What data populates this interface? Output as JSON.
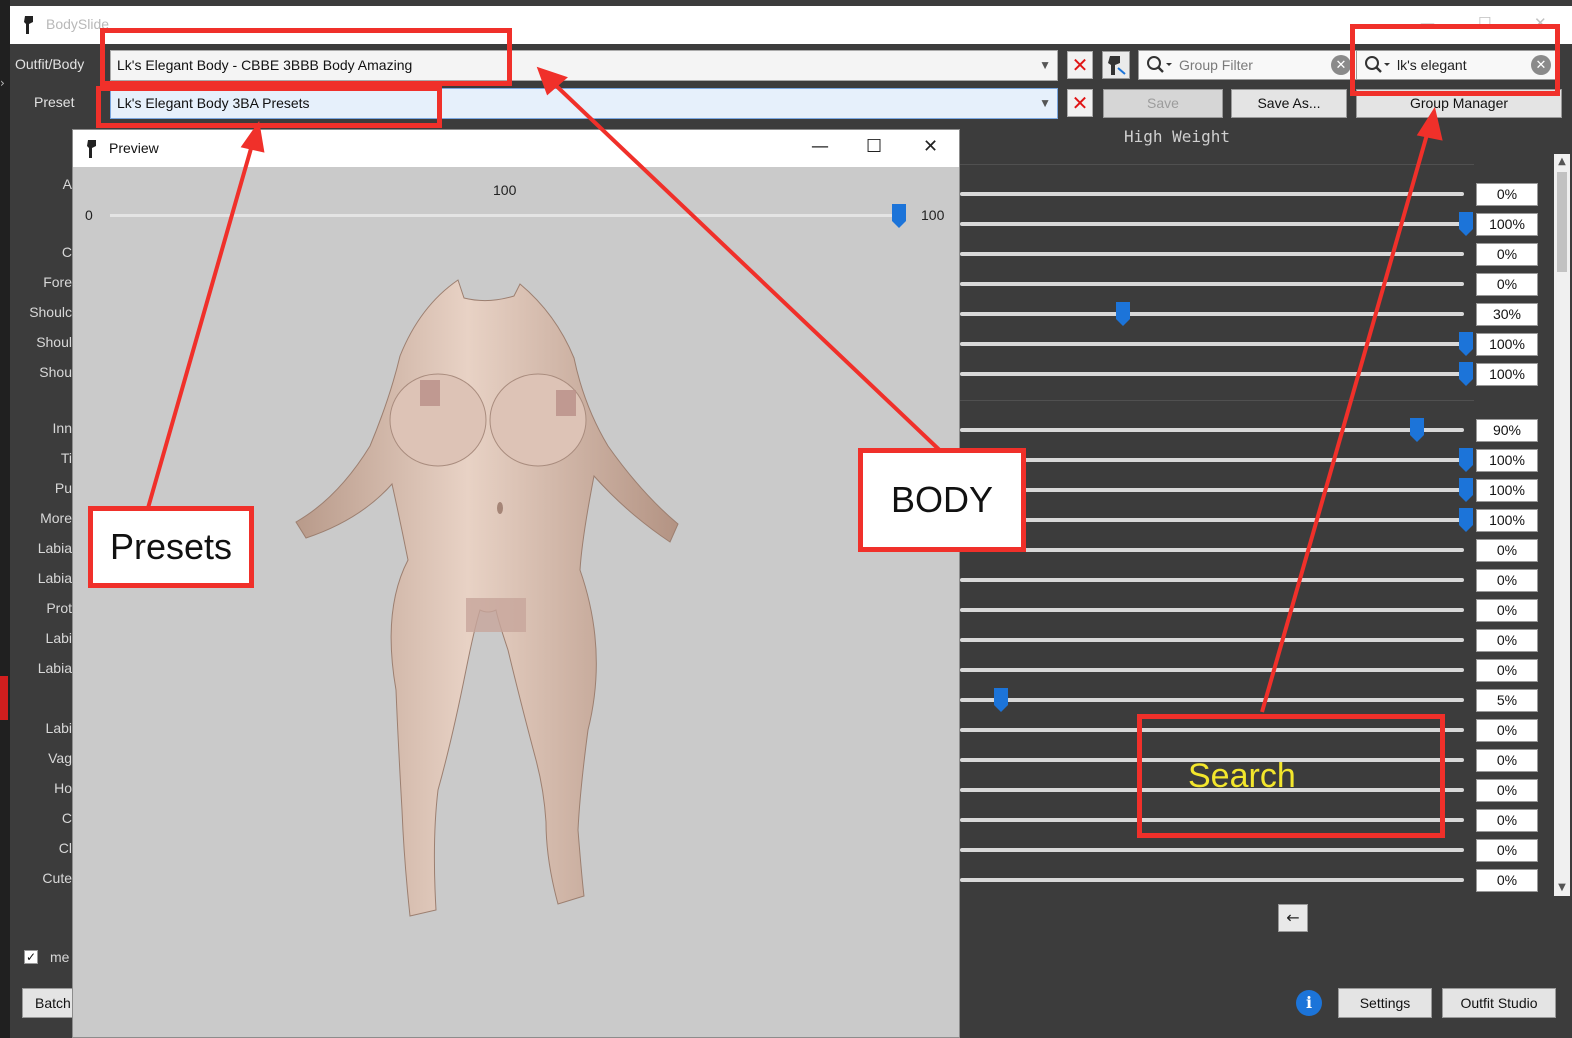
{
  "window": {
    "title": "BodySlide",
    "minimize": "—",
    "maximize": "☐",
    "close": "✕"
  },
  "outfit": {
    "label": "Outfit/Body",
    "value": "Lk's Elegant Body - CBBE 3BBB Body Amazing"
  },
  "preset": {
    "label": "Preset",
    "value": "Lk's Elegant Body 3BA Presets"
  },
  "group_filter": {
    "placeholder": "Group Filter"
  },
  "outfit_search": {
    "value": "lk's elegant"
  },
  "buttons": {
    "save": "Save",
    "save_as": "Save As...",
    "group_manager": "Group Manager",
    "back": "←",
    "info": "i",
    "settings": "Settings",
    "outfit_studio": "Outfit Studio",
    "batch": "Batch",
    "clear": "✕",
    "remove": "✕"
  },
  "weight_header": "High Weight",
  "slider_labels": [
    "A",
    "C",
    "Fore",
    "Shoulc",
    "Shoul",
    "Shou",
    "Inn",
    "Ti",
    "Pu",
    "More",
    "Labia",
    "Labia",
    "Prot",
    "Labi",
    "Labia",
    "Labi",
    "Vag",
    "Ho",
    "C",
    "Cl",
    "Cute"
  ],
  "slider_values": [
    "0%",
    "100%",
    "0%",
    "0%",
    "30%",
    "100%",
    "100%",
    "90%",
    "100%",
    "100%",
    "100%",
    "0%",
    "0%",
    "0%",
    "0%",
    "0%",
    "5%",
    "0%",
    "0%",
    "0%",
    "0%",
    "0%",
    "0%"
  ],
  "slider_levels": [
    0,
    100,
    0,
    0,
    30,
    100,
    100,
    90,
    100,
    100,
    100,
    0,
    0,
    0,
    0,
    0,
    5,
    0,
    0,
    0,
    0,
    0,
    0
  ],
  "checkbox": {
    "label": "me",
    "checked": "✓"
  },
  "preview": {
    "title": "Preview",
    "weight_value": "100",
    "min_label": "0",
    "max_label": "100",
    "weight_level": 100
  },
  "annotations": {
    "presets": "Presets",
    "body": "BODY",
    "search": "Search"
  },
  "colors": {
    "annotation": "#f0302a",
    "search_text": "#f3e62c",
    "slider_thumb": "#1c74d9",
    "panel_bg": "#3c3c3c"
  }
}
